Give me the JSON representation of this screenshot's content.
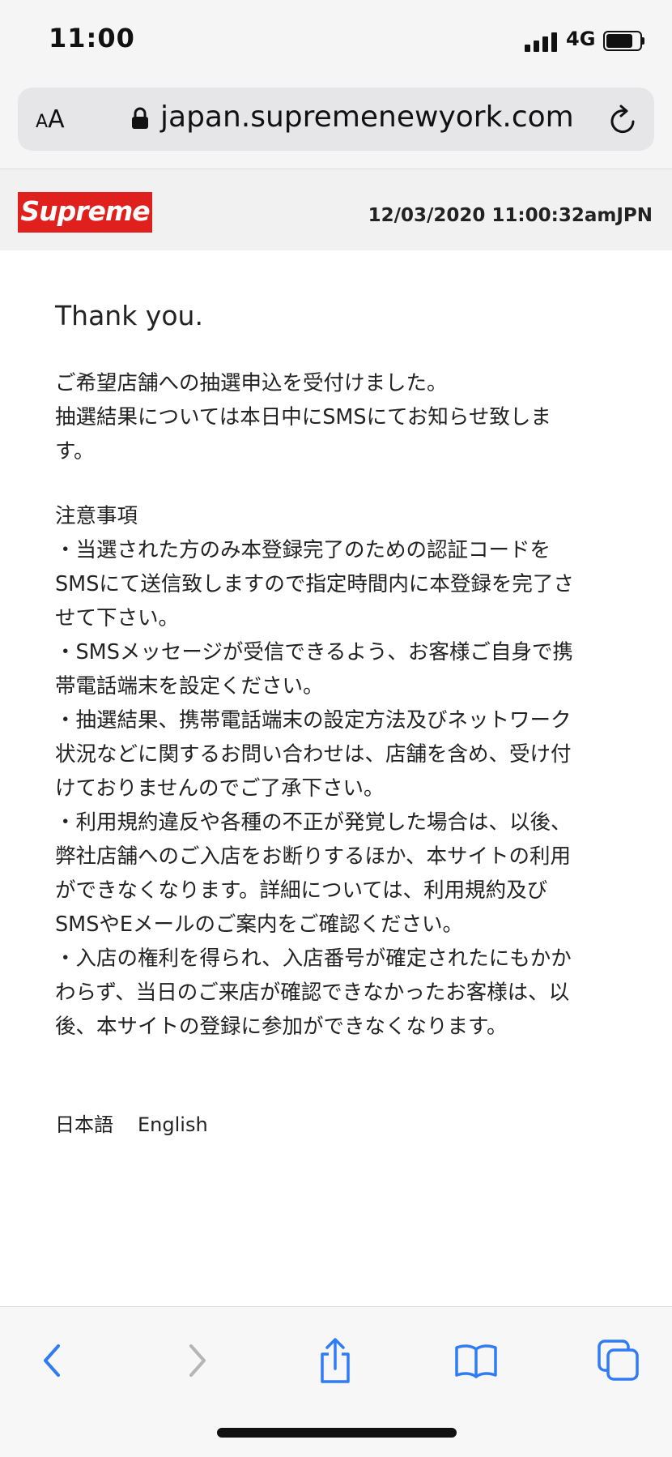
{
  "status_bar": {
    "time": "11:00",
    "network": "4G"
  },
  "address_bar": {
    "text_size_small": "A",
    "text_size_large": "A",
    "url": "japan.supremenewyork.com"
  },
  "site_header": {
    "logo_text": "Supreme",
    "datetime": "12/03/2020 11:00:32amJPN",
    "logo_color": "#e0201d"
  },
  "content": {
    "thanks": "Thank you.",
    "paragraph1": [
      "ご希望店舗への抽選申込を受付けました。",
      "抽選結果については本日中にSMSにてお知らせ致しま",
      "す。"
    ],
    "paragraph2": [
      "注意事項",
      "・当選された方のみ本登録完了のための認証コードを",
      "SMSにて送信致しますので指定時間内に本登録を完了さ",
      "せて下さい。",
      "・SMSメッセージが受信できるよう、お客様ご自身で携",
      "帯電話端末を設定ください。",
      "・抽選結果、携帯電話端末の設定方法及びネットワーク",
      "状況などに関するお問い合わせは、店舗を含め、受け付",
      "けておりませんのでご了承下さい。",
      "・利用規約違反や各種の不正が発覚した場合は、以後、",
      "弊社店舗へのご入店をお断りするほか、本サイトの利用",
      "ができなくなります。詳細については、利用規約及び",
      "SMSやEメールのご案内をご確認ください。",
      "・入店の権利を得られ、入店番号が確定されたにもかか",
      "わらず、当日のご来店が確認できなかったお客様は、以",
      "後、本サイトの登録に参加ができなくなります。"
    ]
  },
  "language_links": {
    "japanese": "日本語",
    "english": "English"
  },
  "toolbar": {
    "icons": [
      "back-icon",
      "forward-icon",
      "share-icon",
      "bookmarks-icon",
      "tabs-icon"
    ],
    "accent_color": "#2f7cf6",
    "disabled_color": "#b5b5b5"
  }
}
